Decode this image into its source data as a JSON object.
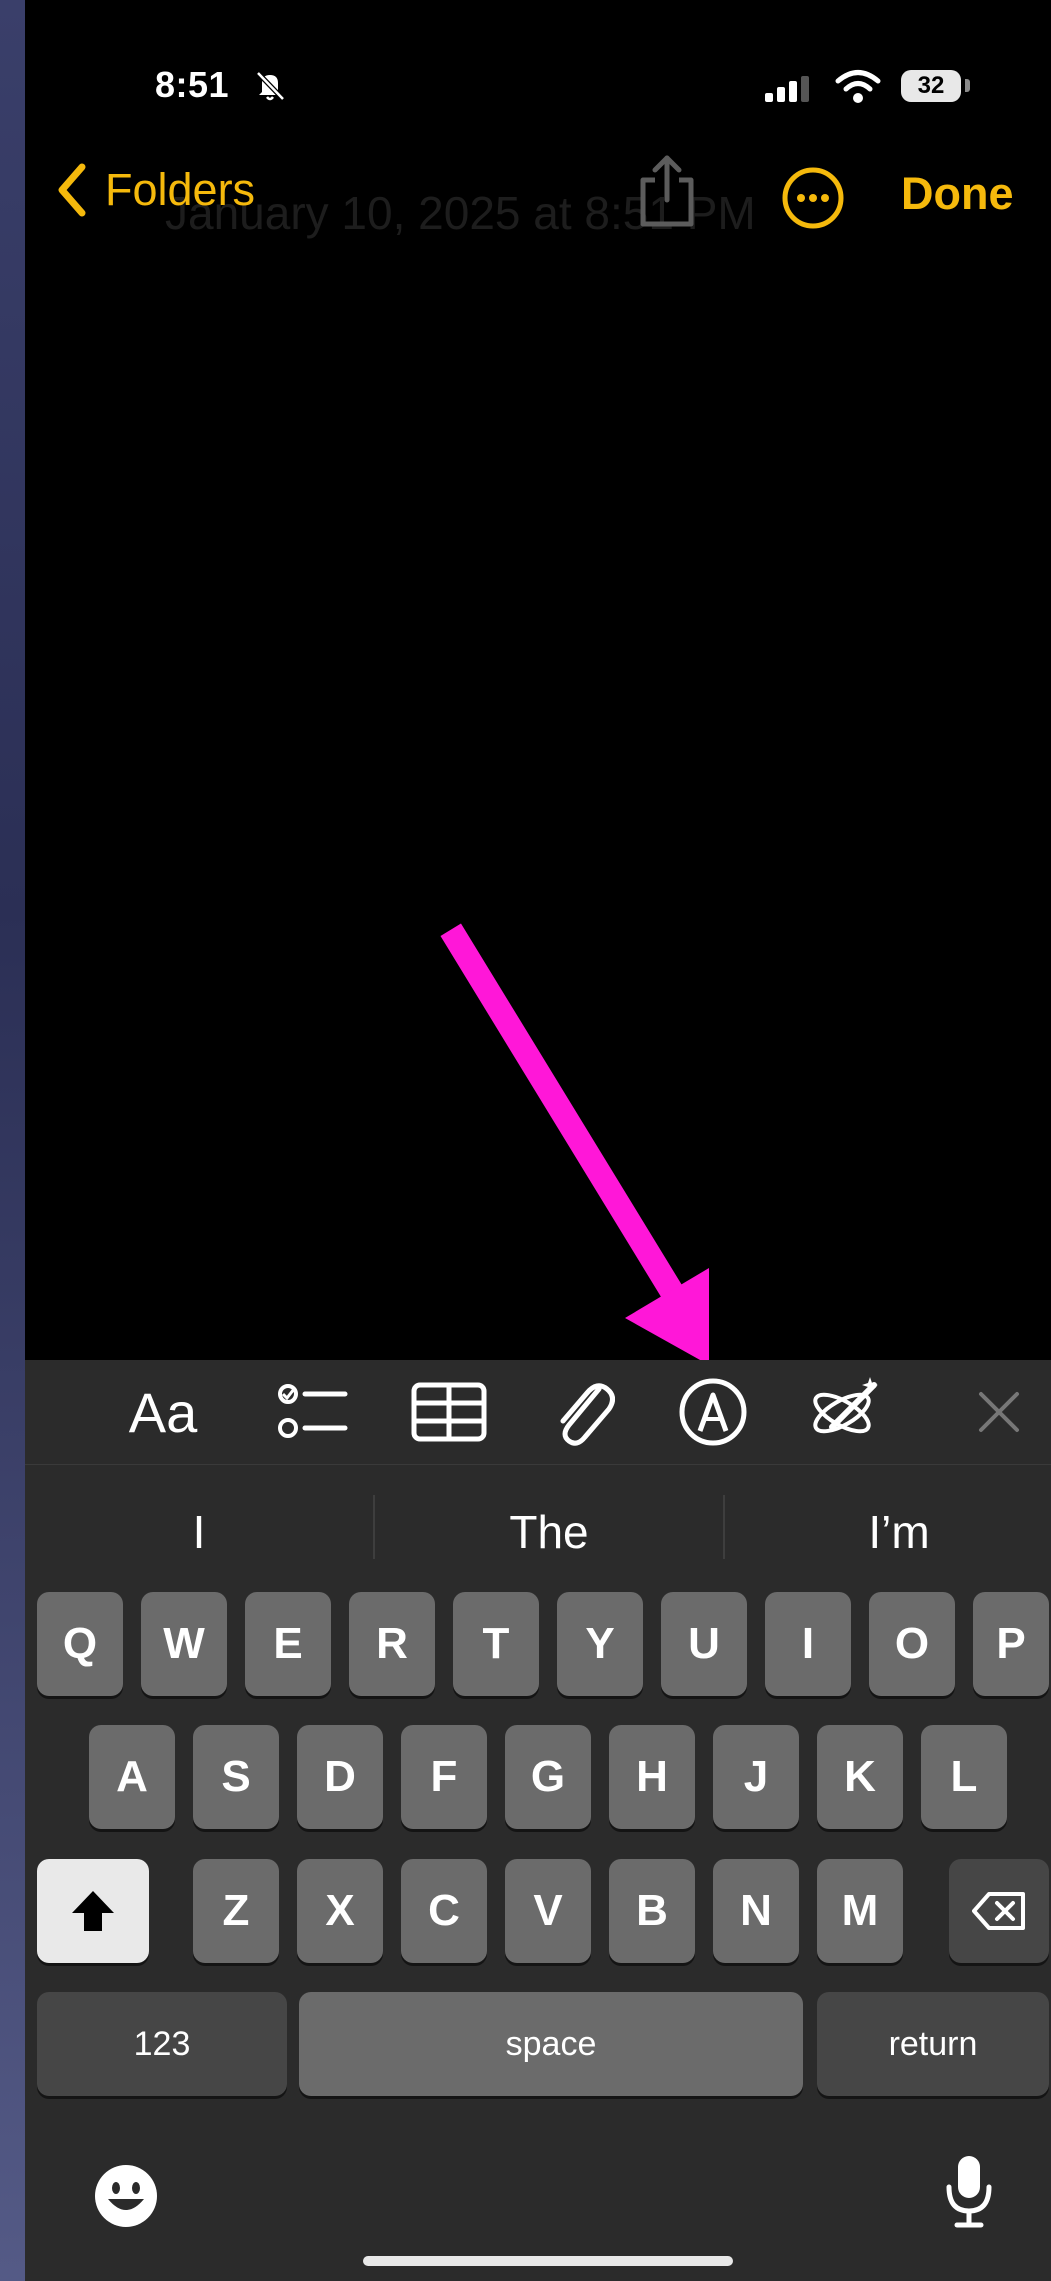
{
  "status_bar": {
    "time": "8:51",
    "battery": "32"
  },
  "nav": {
    "back_label": "Folders",
    "ghost_title": "January 10, 2025 at 8:51 PM",
    "done_label": "Done"
  },
  "toolbar": {
    "format_label": "Aa"
  },
  "suggestions": [
    "I",
    "The",
    "I’m"
  ],
  "keyboard": {
    "row1": [
      "Q",
      "W",
      "E",
      "R",
      "T",
      "Y",
      "U",
      "I",
      "O",
      "P"
    ],
    "row2": [
      "A",
      "S",
      "D",
      "F",
      "G",
      "H",
      "J",
      "K",
      "L"
    ],
    "row3": [
      "Z",
      "X",
      "C",
      "V",
      "B",
      "N",
      "M"
    ],
    "numbers_label": "123",
    "space_label": "space",
    "return_label": "return"
  },
  "colors": {
    "accent": "#f5b90c",
    "annotation": "#ff17d8"
  },
  "icons": [
    "bell-slash-icon",
    "cellular-signal-icon",
    "wifi-icon",
    "battery-icon",
    "chevron-left-icon",
    "share-icon",
    "more-icon",
    "checklist-icon",
    "table-icon",
    "attachment-icon",
    "markup-icon",
    "writing-tools-icon",
    "close-icon",
    "shift-icon",
    "delete-icon",
    "emoji-icon",
    "microphone-icon"
  ]
}
